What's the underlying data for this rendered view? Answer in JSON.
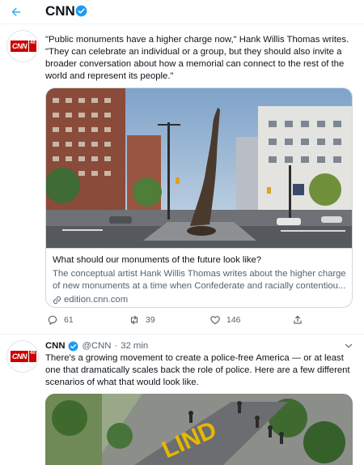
{
  "header": {
    "title": "CNN"
  },
  "tweet1": {
    "avatar_text": "CNN",
    "avatar_badge": "40",
    "lines": [
      "\"Public monuments have a higher charge now,\" Hank Willis Thomas writes.",
      "\"They can celebrate an individual or a group, but they should also invite a",
      "broader conversation about how a memorial can connect to the rest of the",
      "world and represent its people.\""
    ],
    "card": {
      "title": "What should our monuments of the future look like?",
      "desc_line1": "The conceptual artist Hank Willis Thomas writes about the higher charge",
      "desc_line2": "of new monuments at a time when Confederate and racially contentiou...",
      "link": "edition.cnn.com"
    },
    "actions": {
      "replies": "61",
      "retweets": "39",
      "likes": "146"
    }
  },
  "tweet2": {
    "avatar_text": "CNN",
    "avatar_badge": "40",
    "name": "CNN",
    "handle": "@CNN",
    "separator": "·",
    "time": "32 min",
    "lines": [
      "There's a growing movement to create a police-free America — or at least",
      "one that dramatically scales back the role of police. Here are a few different",
      "scenarios of what that would look like."
    ],
    "image_text": "LIND"
  },
  "colors": {
    "accent": "#1d9bf0",
    "brand_red": "#cc0000",
    "secondary_text": "#536471"
  }
}
